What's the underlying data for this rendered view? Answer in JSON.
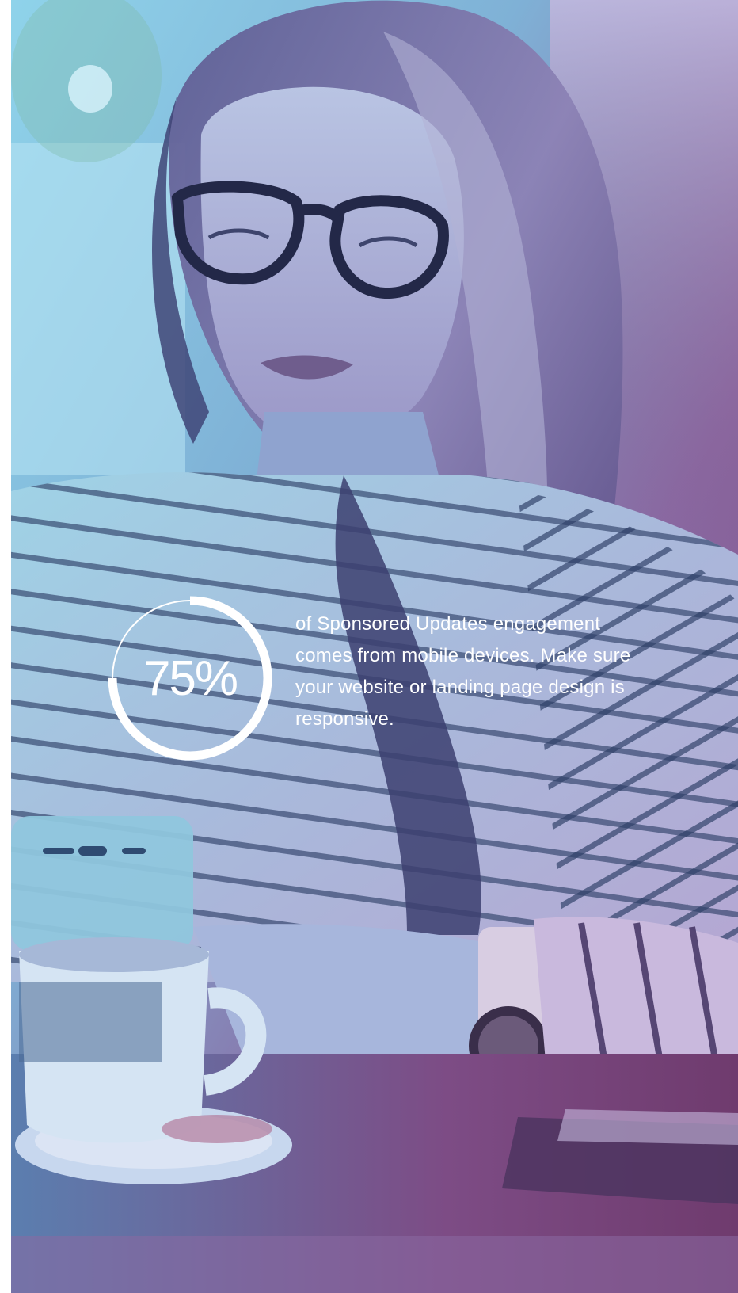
{
  "stat": {
    "value_label": "75%",
    "fraction": 0.75,
    "caption": "of Sponsored Updates engagement comes from mobile devices. Make sure your website or landing page design is responsive."
  },
  "photo": {
    "subject": "woman-using-smartphone-in-cafe",
    "overlay_colors": [
      "#79c3df",
      "#8a6aa3",
      "#7a3f73"
    ]
  },
  "colors": {
    "ring": "#ffffff",
    "text": "#ffffff"
  }
}
